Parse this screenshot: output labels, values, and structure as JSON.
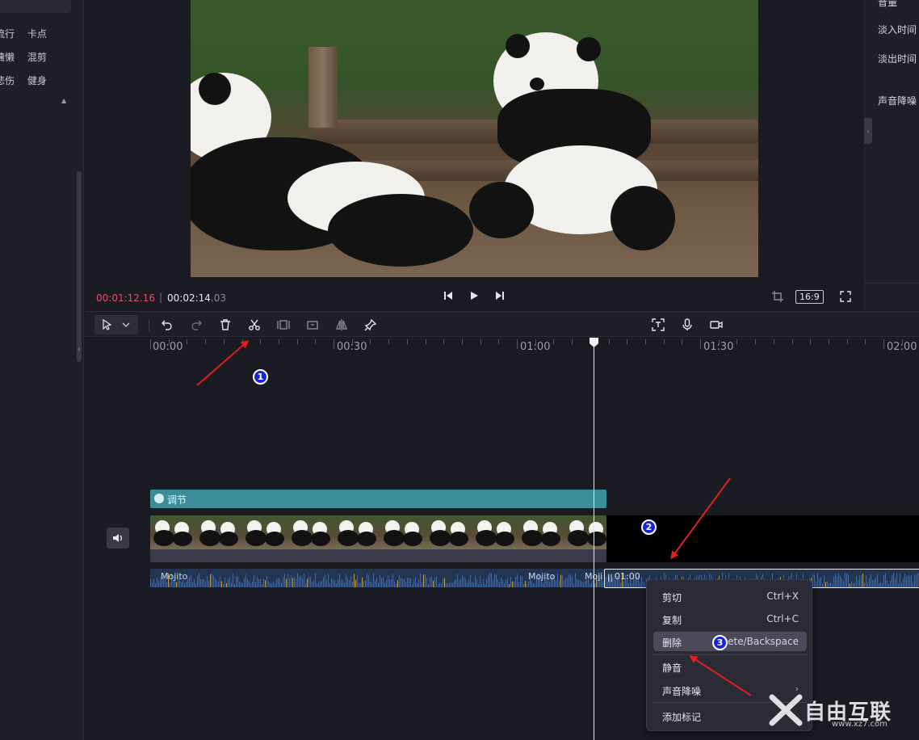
{
  "left_panel": {
    "tags_row1": [
      "流行",
      "卡点"
    ],
    "tags_row2": [
      "慵懒",
      "混剪"
    ],
    "tags_row3": [
      "悲伤",
      "健身"
    ]
  },
  "player": {
    "current_time": "00:01:12.16",
    "separator": "|",
    "total_time_main": "00:02:14",
    "total_time_ms": ".03",
    "aspect_ratio": "16:9"
  },
  "right_panel": {
    "prop_top": "音量",
    "fade_in": "淡入时间",
    "fade_out": "淡出时间",
    "noise_reduction": "声音降噪"
  },
  "timeline": {
    "ruler": [
      "00:00",
      "00:30",
      "01:00",
      "01:30",
      "02:00"
    ],
    "adjust_track_label": "调节",
    "audio_labels": [
      "Mojito",
      "Mojito",
      "Moji"
    ],
    "audio_selected_time": "01:00"
  },
  "context_menu": {
    "items": [
      {
        "label": "剪切",
        "shortcut": "Ctrl+X"
      },
      {
        "label": "复制",
        "shortcut": "Ctrl+C"
      },
      {
        "label": "删除",
        "shortcut": "ete/Backspace"
      },
      {
        "label": "静音",
        "shortcut": ""
      },
      {
        "label": "声音降噪",
        "shortcut": ""
      },
      {
        "label": "添加标记",
        "shortcut": ""
      }
    ]
  },
  "annotations": {
    "badge1": "1",
    "badge2": "2",
    "badge3": "3"
  },
  "watermark": {
    "brand": "自由互联",
    "url": "www.xz7.com"
  },
  "colors": {
    "current_time": "#e0506a",
    "adjust_track": "#3b8d99",
    "annotation_arrow": "#e02020",
    "badge": "#1a24d6"
  }
}
